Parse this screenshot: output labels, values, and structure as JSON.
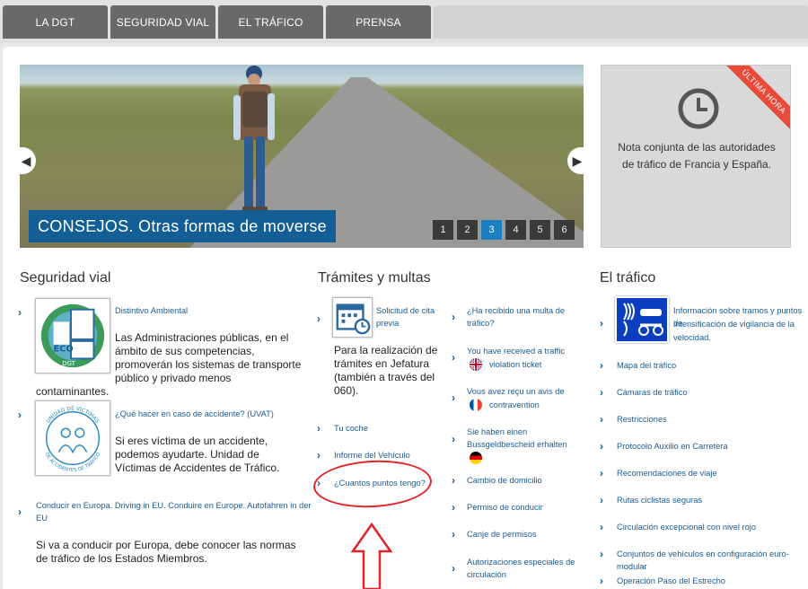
{
  "nav": {
    "tabs": [
      {
        "label": "LA DGT"
      },
      {
        "label": "SEGURIDAD VIAL"
      },
      {
        "label": "EL TRÁFICO"
      },
      {
        "label": "PRENSA"
      }
    ]
  },
  "slider": {
    "caption": "CONSEJOS. Otras formas de moverse",
    "prev_icon": "chevron-left-icon",
    "next_icon": "chevron-right-icon",
    "pages": [
      "1",
      "2",
      "3",
      "4",
      "5",
      "6"
    ],
    "active_page": "3"
  },
  "news": {
    "ribbon": "ÚLTIMA HORA",
    "icon": "clock-icon",
    "text": "Nota conjunta de las autoridades de tráfico de Francia y España."
  },
  "seguridad": {
    "title": "Seguridad vial",
    "item1": {
      "link": "Distintivo Ambiental",
      "text_a": "Las Administraciones públicas, en el",
      "text_b": "ámbito de sus competencias,",
      "text_c": "promoverán los sistemas de transporte",
      "text_d": "público y privado menos",
      "text_e": "contaminantes."
    },
    "item2": {
      "link": "¿Qué hacer en caso de accidente? (UVAT)",
      "text_a": "Si eres víctima de un accidente,",
      "text_b": "podemos ayudarte. Unidad de",
      "text_c": "Víctimas de Accidentes de Tráfico."
    },
    "item3": {
      "link_a": "Conducir en Europa. Driving in EU. Conduire en Europe. Autofahren in der",
      "link_b": "EU",
      "text_a": "Si va a conducir por Europa, debe conocer las normas",
      "text_b": "de tráfico de los Estados Miembros."
    },
    "eco_label": "ECO",
    "dgt_label": "DGT",
    "uvat_ring_top": "UNIDAD DE VÍCTIMAS",
    "uvat_ring_bottom": "DE ACCIDENTES DE TRÁFICO"
  },
  "tramites": {
    "title": "Trámites y multas",
    "cita_link_a": "Solicitud de cita",
    "cita_link_b": "previa",
    "cita_text_a": "Para la realización de",
    "cita_text_b": "trámites en Jefatura",
    "cita_text_c": "(también a través del",
    "cita_text_d": "060).",
    "left_links": [
      "Tu coche",
      "Informe del Vehículo",
      "¿Cuantos puntos tengo?"
    ],
    "right": {
      "multa_a": "¿Ha recibido una multa de",
      "multa_b": "tráfico?",
      "en_a": "You have received a traffic",
      "en_b": "violation ticket",
      "fr_a": "Vous avez reçu un avis de",
      "fr_b": "contravention",
      "de_a": "Sie haben einen",
      "de_b": "Bussgeldbescheid erhalten",
      "links": [
        "Cambio de domicilio",
        "Permiso de conducir",
        "Canje de permisos"
      ],
      "auto_a": "Autorizaciones especiales de",
      "auto_b": "circulación"
    }
  },
  "trafico": {
    "title": "El tráfico",
    "info_a": "Información sobre tramos y puntos de",
    "info_b": "intensificación de vigilancia de la",
    "info_c": "velocidad.",
    "links": [
      "Mapa del tráfico",
      "Cámaras de tráfico",
      "Restricciones",
      "Protocolo Auxilio en Carretera",
      "Recomendaciones de viaje",
      "Rutas ciclistas seguras",
      "Circulación excepcional con nivel rojo",
      "Conjuntos de vehículos en configuración euro-modular",
      "Operación Paso del Estrecho"
    ]
  },
  "colors": {
    "nav_tab": "#696969",
    "link": "#1a5a93",
    "caption_bg": "#135e95",
    "active_page": "#1b7fc0",
    "ribbon": "#e84b3a",
    "annotation": "#e0242a"
  }
}
